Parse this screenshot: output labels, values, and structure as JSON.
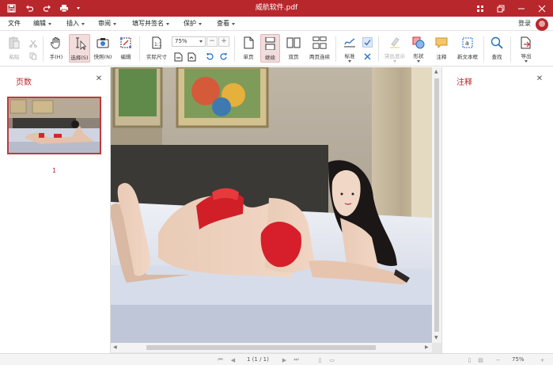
{
  "app": {
    "title": "威航软件.pdf"
  },
  "menu": {
    "items": [
      "文件",
      "编辑",
      "插入",
      "审阅",
      "填写并签名",
      "保护",
      "查看"
    ],
    "login": "登录"
  },
  "toolbar": {
    "paste": "粘贴",
    "hand": "手(H)",
    "select": "选择(S)",
    "snapshot": "快照(N)",
    "edit": "编辑",
    "actual_size": "实际尺寸",
    "zoom_value": "75%",
    "single_page": "单页",
    "continuous": "继续",
    "two_page": "双页",
    "two_page_continuous": "两页连续",
    "sign": "标准",
    "highlight": "突出显示",
    "shape": "形状",
    "comment": "注释",
    "text_box": "新文本框",
    "find": "查找",
    "export": "导出"
  },
  "left_panel": {
    "title": "页数",
    "page_number": "1"
  },
  "right_panel": {
    "title": "注释"
  },
  "status": {
    "page_info": "1 (1 / 1)",
    "zoom": "75%"
  },
  "colors": {
    "accent": "#b8272c",
    "selected_tool_bg": "#f2dcdc"
  },
  "icons": [
    "save-icon",
    "undo-icon",
    "redo-icon",
    "print-icon",
    "grid-icon",
    "restore-icon",
    "minimize-icon",
    "maximize-icon",
    "close-icon"
  ]
}
